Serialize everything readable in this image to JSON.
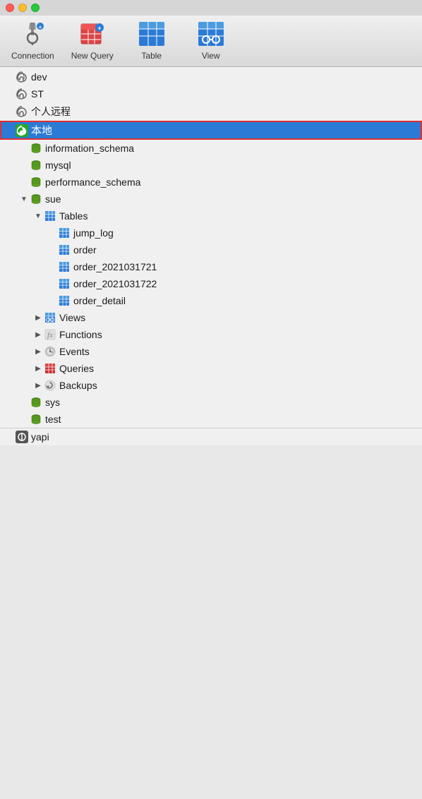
{
  "titlebar": {
    "buttons": [
      "close",
      "minimize",
      "maximize"
    ]
  },
  "toolbar": {
    "items": [
      {
        "id": "connection",
        "label": "Connection",
        "icon": "connection-icon"
      },
      {
        "id": "new-query",
        "label": "New Query",
        "icon": "new-query-icon"
      },
      {
        "id": "table",
        "label": "Table",
        "icon": "table-icon"
      },
      {
        "id": "view",
        "label": "View",
        "icon": "view-icon"
      }
    ]
  },
  "tree": {
    "items": [
      {
        "id": "dev",
        "label": "dev",
        "indent": 0,
        "icon": "leaf",
        "chevron": "none",
        "selected": false
      },
      {
        "id": "st",
        "label": "ST",
        "indent": 0,
        "icon": "leaf",
        "chevron": "none",
        "selected": false
      },
      {
        "id": "personal-remote",
        "label": "个人远程",
        "indent": 0,
        "icon": "leaf",
        "chevron": "none",
        "selected": false
      },
      {
        "id": "local",
        "label": "本地",
        "indent": 0,
        "icon": "green-leaf",
        "chevron": "none",
        "selected": true,
        "highlight": true
      },
      {
        "id": "information_schema",
        "label": "information_schema",
        "indent": 1,
        "icon": "database",
        "chevron": "none",
        "selected": false
      },
      {
        "id": "mysql",
        "label": "mysql",
        "indent": 1,
        "icon": "database",
        "chevron": "none",
        "selected": false
      },
      {
        "id": "performance_schema",
        "label": "performance_schema",
        "indent": 1,
        "icon": "database",
        "chevron": "none",
        "selected": false
      },
      {
        "id": "sue",
        "label": "sue",
        "indent": 1,
        "icon": "database-green",
        "chevron": "down",
        "selected": false
      },
      {
        "id": "tables",
        "label": "Tables",
        "indent": 2,
        "icon": "table",
        "chevron": "down",
        "selected": false
      },
      {
        "id": "jump_log",
        "label": "jump_log",
        "indent": 3,
        "icon": "table",
        "chevron": "none",
        "selected": false
      },
      {
        "id": "order",
        "label": "order",
        "indent": 3,
        "icon": "table",
        "chevron": "none",
        "selected": false
      },
      {
        "id": "order_2021031721",
        "label": "order_2021031721",
        "indent": 3,
        "icon": "table",
        "chevron": "none",
        "selected": false
      },
      {
        "id": "order_2021031722",
        "label": "order_2021031722",
        "indent": 3,
        "icon": "table",
        "chevron": "none",
        "selected": false
      },
      {
        "id": "order_detail",
        "label": "order_detail",
        "indent": 3,
        "icon": "table",
        "chevron": "none",
        "selected": false
      },
      {
        "id": "views",
        "label": "Views",
        "indent": 2,
        "icon": "views",
        "chevron": "right",
        "selected": false
      },
      {
        "id": "functions",
        "label": "Functions",
        "indent": 2,
        "icon": "functions",
        "chevron": "right",
        "selected": false
      },
      {
        "id": "events",
        "label": "Events",
        "indent": 2,
        "icon": "events",
        "chevron": "right",
        "selected": false
      },
      {
        "id": "queries",
        "label": "Queries",
        "indent": 2,
        "icon": "queries",
        "chevron": "right",
        "selected": false
      },
      {
        "id": "backups",
        "label": "Backups",
        "indent": 2,
        "icon": "backups",
        "chevron": "right",
        "selected": false
      },
      {
        "id": "sys",
        "label": "sys",
        "indent": 1,
        "icon": "database",
        "chevron": "none",
        "selected": false
      },
      {
        "id": "test",
        "label": "test",
        "indent": 1,
        "icon": "database",
        "chevron": "none",
        "selected": false
      },
      {
        "id": "yapi",
        "label": "yapi",
        "indent": 0,
        "icon": "yapi-leaf",
        "chevron": "none",
        "selected": false
      }
    ]
  }
}
